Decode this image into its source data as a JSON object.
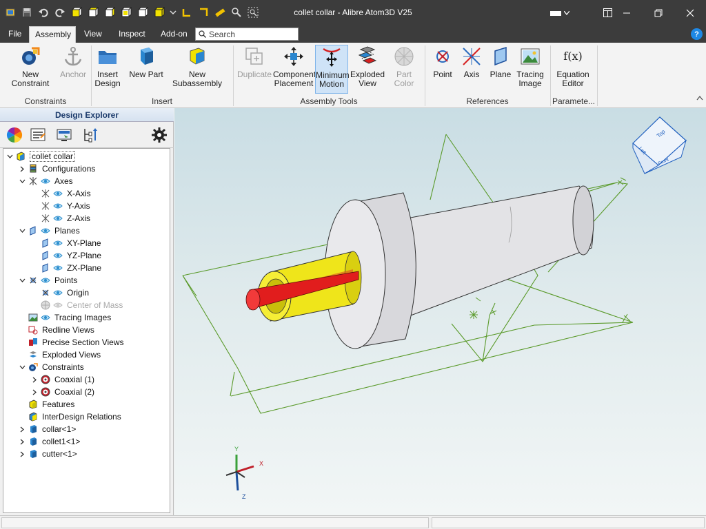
{
  "window": {
    "title": "collet collar - Alibre Atom3D V25",
    "controls": [
      "minimize-icon",
      "restore-icon",
      "close-icon"
    ]
  },
  "quick_access": {
    "icons": [
      "app-logo-icon",
      "save-icon",
      "undo-icon",
      "redo-icon",
      "view-front-icon",
      "view-back-icon",
      "view-left-icon",
      "view-right-icon",
      "view-top-icon",
      "view-iso-icon",
      "more-icon",
      "constraint-add-icon",
      "constraint-remove-icon",
      "measure-icon",
      "zoom-icon",
      "zoom-area-icon"
    ]
  },
  "menu": {
    "items": [
      "File",
      "Assembly",
      "View",
      "Inspect",
      "Add-on"
    ],
    "active": "Assembly",
    "search_placeholder": "Search"
  },
  "ribbon": {
    "groups": [
      {
        "label": "Constraints",
        "buttons": [
          {
            "label_1": "New Constraint",
            "label_2": "",
            "icon": "new-constraint-icon",
            "disabled": false
          },
          {
            "label_1": "Anchor",
            "label_2": "",
            "icon": "anchor-icon",
            "disabled": true
          }
        ]
      },
      {
        "label": "Insert",
        "buttons": [
          {
            "label_1": "Insert",
            "label_2": "Design",
            "icon": "folder-icon",
            "disabled": false
          },
          {
            "label_1": "New Part",
            "label_2": "",
            "icon": "new-part-icon",
            "disabled": false
          },
          {
            "label_1": "New Subassembly",
            "label_2": "",
            "icon": "new-subassembly-icon",
            "disabled": false
          }
        ]
      },
      {
        "label": "Assembly Tools",
        "buttons": [
          {
            "label_1": "Duplicate",
            "label_2": "",
            "icon": "duplicate-icon",
            "disabled": true
          },
          {
            "label_1": "Component",
            "label_2": "Placement",
            "icon": "move-icon",
            "disabled": false
          },
          {
            "label_1": "Minimum",
            "label_2": "Motion",
            "icon": "minimum-motion-icon",
            "disabled": false,
            "pressed": true
          },
          {
            "label_1": "Exploded",
            "label_2": "View",
            "icon": "exploded-view-icon",
            "disabled": false
          },
          {
            "label_1": "Part Color",
            "label_2": "",
            "icon": "part-color-icon",
            "disabled": true
          }
        ]
      },
      {
        "label": "References",
        "buttons": [
          {
            "label_1": "Point",
            "label_2": "",
            "icon": "point-icon",
            "disabled": false
          },
          {
            "label_1": "Axis",
            "label_2": "",
            "icon": "axis-icon",
            "disabled": false
          },
          {
            "label_1": "Plane",
            "label_2": "",
            "icon": "plane-icon",
            "disabled": false
          },
          {
            "label_1": "Tracing",
            "label_2": "Image",
            "icon": "tracing-image-icon",
            "disabled": false
          }
        ]
      },
      {
        "label": "Paramete...",
        "buttons": [
          {
            "label_1": "Equation",
            "label_2": "Editor",
            "icon": "equation-icon",
            "disabled": false,
            "glyph": "f(x)"
          }
        ]
      }
    ]
  },
  "design_explorer": {
    "title": "Design Explorer",
    "tree": [
      {
        "label": "collet collar",
        "icon": "assembly-icon",
        "eye": false,
        "exp": "v",
        "selected": true
      },
      {
        "label": "Configurations",
        "icon": "configurations-icon",
        "eye": false,
        "exp": ">"
      },
      {
        "label": "Axes",
        "icon": "axes-icon",
        "eye": true,
        "exp": "v"
      },
      {
        "label": "X-Axis",
        "icon": "axis-small-icon",
        "eye": true,
        "exp": ""
      },
      {
        "label": "Y-Axis",
        "icon": "axis-small-icon",
        "eye": true,
        "exp": ""
      },
      {
        "label": "Z-Axis",
        "icon": "axis-small-icon",
        "eye": true,
        "exp": ""
      },
      {
        "label": "Planes",
        "icon": "planes-icon",
        "eye": true,
        "exp": "v"
      },
      {
        "label": "XY-Plane",
        "icon": "plane-small-icon",
        "eye": true,
        "exp": ""
      },
      {
        "label": "YZ-Plane",
        "icon": "plane-small-icon",
        "eye": true,
        "exp": ""
      },
      {
        "label": "ZX-Plane",
        "icon": "plane-small-icon",
        "eye": true,
        "exp": ""
      },
      {
        "label": "Points",
        "icon": "points-icon",
        "eye": true,
        "exp": "v"
      },
      {
        "label": "Origin",
        "icon": "point-small-icon",
        "eye": true,
        "exp": ""
      },
      {
        "label": "Center of Mass",
        "icon": "center-of-mass-icon",
        "eye": true,
        "exp": "",
        "dim": true
      },
      {
        "label": "Tracing Images",
        "icon": "tracing-images-icon",
        "eye": true,
        "exp": ""
      },
      {
        "label": "Redline Views",
        "icon": "redline-icon",
        "eye": false,
        "exp": ""
      },
      {
        "label": "Precise Section Views",
        "icon": "section-icon",
        "eye": false,
        "exp": ""
      },
      {
        "label": "Exploded Views",
        "icon": "exploded-views-icon",
        "eye": false,
        "exp": ""
      },
      {
        "label": "Constraints",
        "icon": "constraints-icon",
        "eye": false,
        "exp": "v"
      },
      {
        "label": "Coaxial (1)",
        "icon": "coaxial-icon",
        "eye": false,
        "exp": ">"
      },
      {
        "label": "Coaxial (2)",
        "icon": "coaxial-icon",
        "eye": false,
        "exp": ">"
      },
      {
        "label": "Features",
        "icon": "features-icon",
        "eye": false,
        "exp": ""
      },
      {
        "label": "InterDesign Relations",
        "icon": "relations-icon",
        "eye": false,
        "exp": ""
      },
      {
        "label": "collar<1>",
        "icon": "part-icon",
        "eye": false,
        "exp": ">"
      },
      {
        "label": "collet1<1>",
        "icon": "part-icon",
        "eye": false,
        "exp": ">"
      },
      {
        "label": "cutter<1>",
        "icon": "part-icon",
        "eye": false,
        "exp": ">"
      }
    ]
  },
  "viewport": {
    "view_cube": {
      "top": "Top",
      "left": "Left",
      "front": "Front"
    },
    "triad": {
      "x": "X",
      "y": "Y",
      "z": "Z"
    }
  },
  "colors": {
    "plane_green": "#5a9a2a",
    "collet_yellow": "#f4ea16",
    "cutter_red": "#e11d1d",
    "collar_grey": "#e4e4e6",
    "accent_blue": "#1e88e5"
  }
}
